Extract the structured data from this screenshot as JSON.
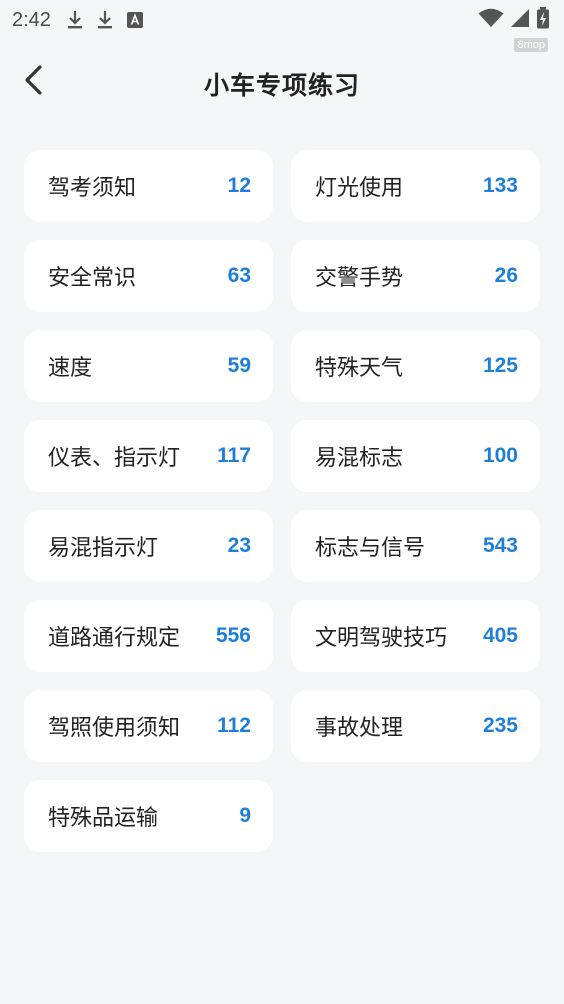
{
  "status_bar": {
    "time": "2:42",
    "icons_left": [
      "download-icon",
      "download-icon",
      "a-notification-icon"
    ],
    "icons_right": [
      "wifi-icon",
      "signal-icon",
      "battery-icon"
    ],
    "watermark": "8mop"
  },
  "header": {
    "back_icon": "chevron-left-icon",
    "title": "小车专项练习"
  },
  "colors": {
    "background": "#f5f6f8",
    "card": "#ffffff",
    "count": "#1f7fd6",
    "text": "#222222"
  },
  "categories": [
    {
      "label": "驾考须知",
      "count": "12"
    },
    {
      "label": "灯光使用",
      "count": "133"
    },
    {
      "label": "安全常识",
      "count": "63"
    },
    {
      "label": "交警手势",
      "count": "26"
    },
    {
      "label": "速度",
      "count": "59"
    },
    {
      "label": "特殊天气",
      "count": "125"
    },
    {
      "label": "仪表、指示灯",
      "count": "117"
    },
    {
      "label": "易混标志",
      "count": "100"
    },
    {
      "label": "易混指示灯",
      "count": "23"
    },
    {
      "label": "标志与信号",
      "count": "543"
    },
    {
      "label": "道路通行规定",
      "count": "556"
    },
    {
      "label": "文明驾驶技巧",
      "count": "405"
    },
    {
      "label": "驾照使用须知",
      "count": "112"
    },
    {
      "label": "事故处理",
      "count": "235"
    },
    {
      "label": "特殊品运输",
      "count": "9"
    }
  ]
}
